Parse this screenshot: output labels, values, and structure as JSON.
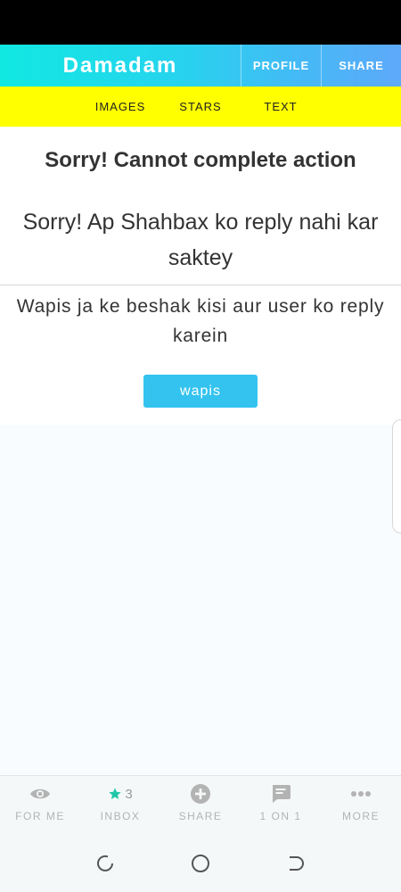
{
  "app": {
    "brand": "Damadam",
    "top_buttons": [
      "PROFILE",
      "SHARE"
    ]
  },
  "subnav": [
    "IMAGES",
    "STARS",
    "TEXT"
  ],
  "dialog": {
    "header": "Sorry! Cannot complete action",
    "message": "Sorry! Ap Shahbax ko reply nahi kar saktey",
    "hint": "Wapis ja ke beshak kisi aur user ko reply karein",
    "button": "wapis"
  },
  "bottom_nav": {
    "for_me": "FOR ME",
    "inbox": "INBOX",
    "inbox_count": "3",
    "share": "SHARE",
    "one_on_one": "1 ON 1",
    "more": "MORE"
  },
  "colors": {
    "accent": "#34c3ef",
    "subnav_bg": "#ffff00",
    "inbox_star": "#1fc7a8"
  },
  "icons": {
    "for_me": "eye-icon",
    "inbox": "star-icon",
    "share": "plus-circle-icon",
    "one_on_one": "chat-icon",
    "more": "dots-icon",
    "system": [
      "recent-apps-icon",
      "home-icon",
      "back-icon"
    ]
  }
}
